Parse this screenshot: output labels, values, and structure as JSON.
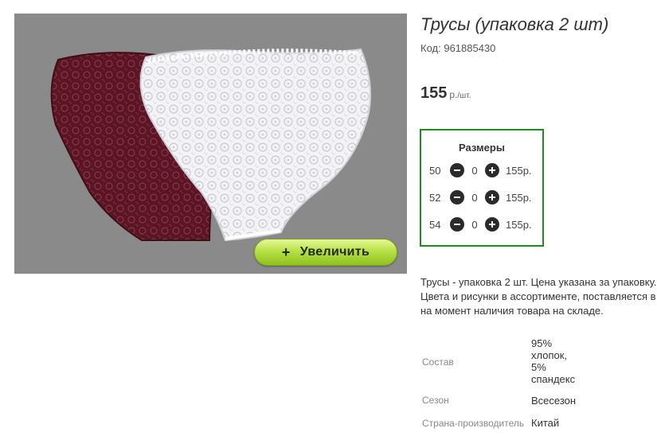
{
  "product": {
    "title": "Трусы (упаковка 2 шт)",
    "code_label": "Код:",
    "code_value": "961885430",
    "price_amount": "155",
    "price_unit": "р.",
    "price_per": "/шт."
  },
  "image": {
    "zoom_plus": "+",
    "zoom_label": "Увеличить",
    "colors": {
      "burgundy": "#5a1624",
      "white": "#f3f3f6",
      "background": "#8a8a8a"
    }
  },
  "sizes": {
    "heading": "Размеры",
    "rows": [
      {
        "size": "50",
        "qty": "0",
        "price": "155р."
      },
      {
        "size": "52",
        "qty": "0",
        "price": "155р."
      },
      {
        "size": "54",
        "qty": "0",
        "price": "155р."
      }
    ],
    "minus_icon": "minus-circle-icon",
    "plus_icon": "plus-circle-icon",
    "border_color": "#1f8a1f"
  },
  "description": {
    "line1": "Трусы - упаковка 2 шт. Цена указана за упаковку.",
    "line2": "Цвета и рисунки в ассортименте, поставляется в",
    "line3": "на момент наличия товара на складе."
  },
  "attributes": {
    "composition_label": "Состав",
    "composition_lines": [
      "95%",
      "хлопок,",
      "5%",
      "спандекс"
    ],
    "season_label": "Сезон",
    "season_value": "Всесезон",
    "country_label": "Страна-производитель",
    "country_value": "Китай"
  }
}
